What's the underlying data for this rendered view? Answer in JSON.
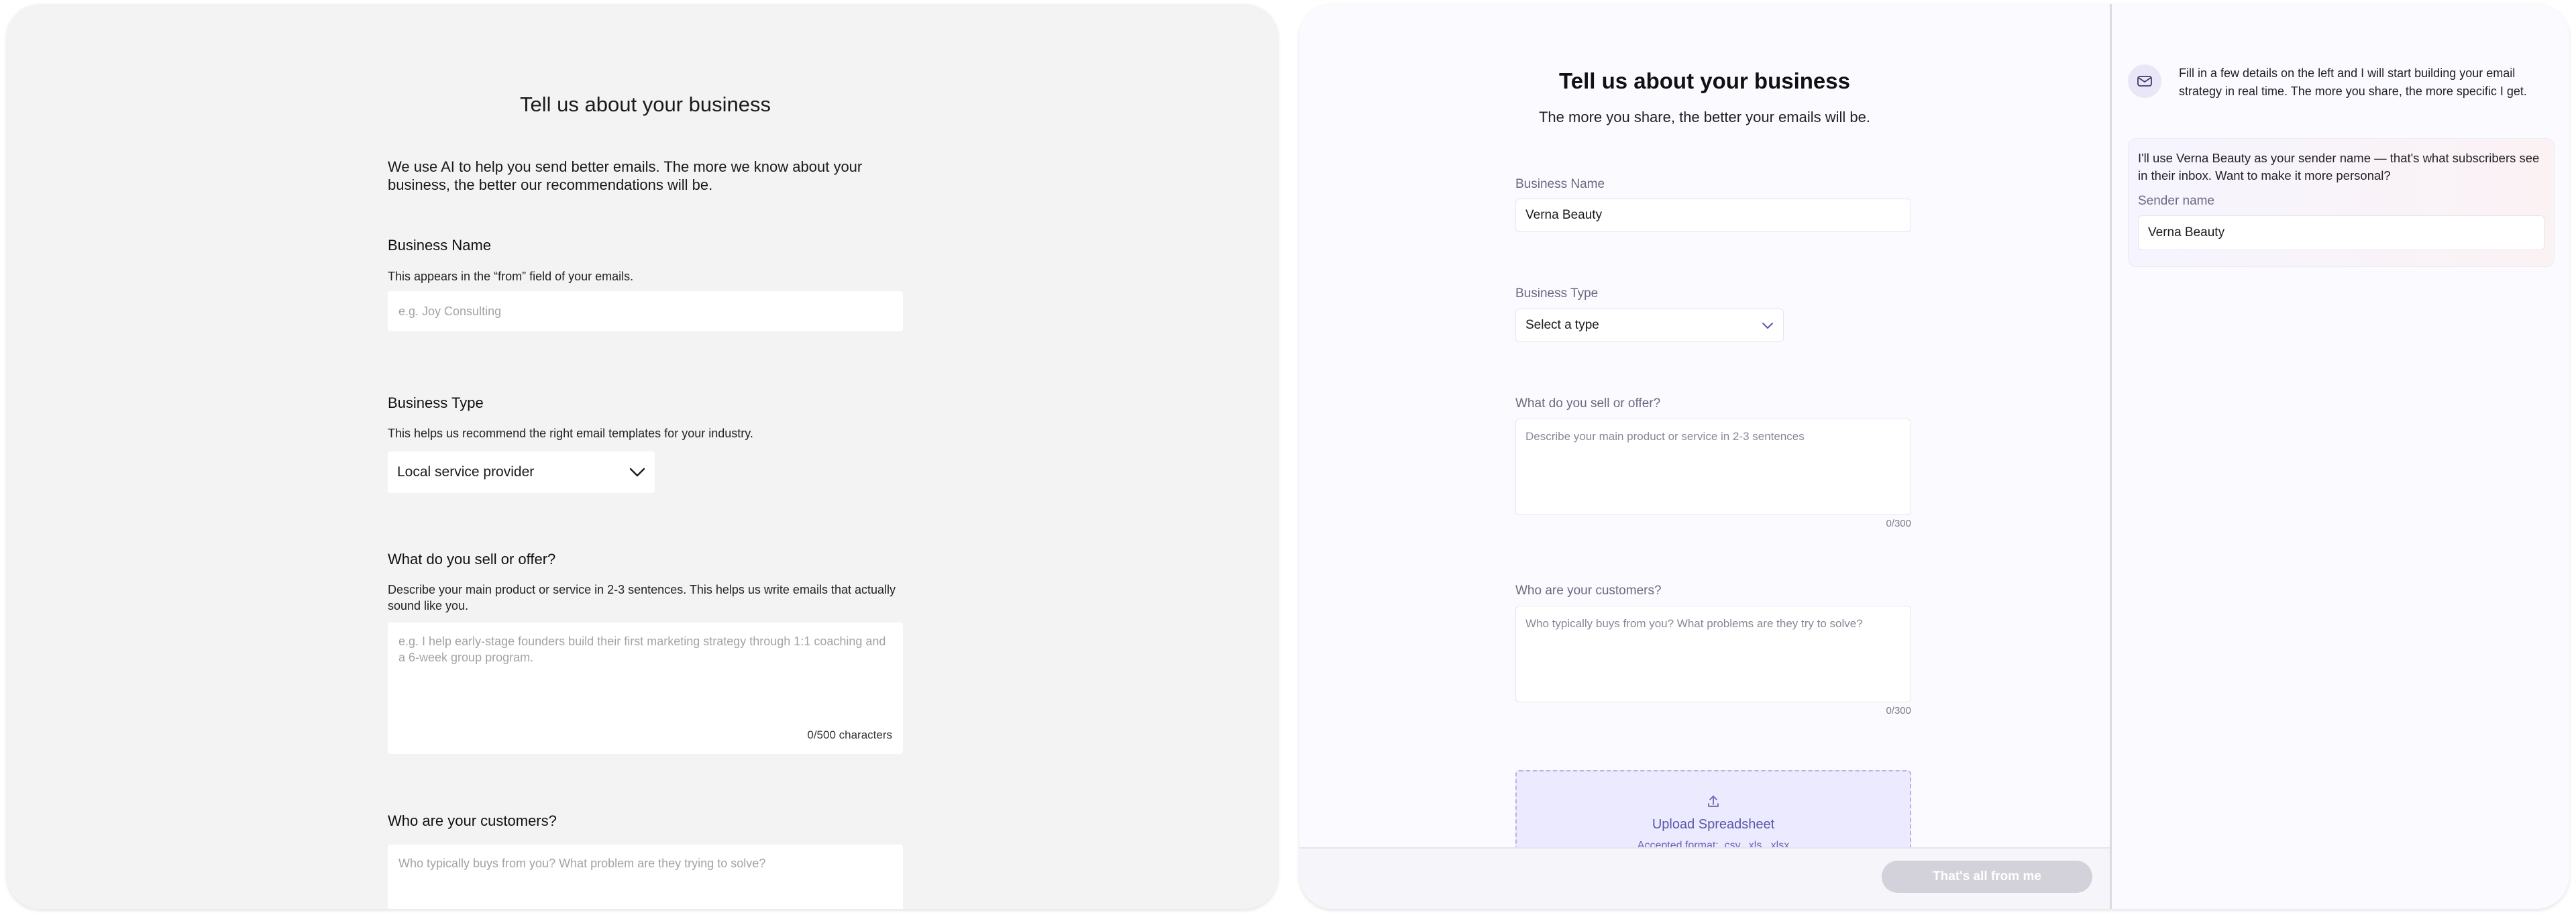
{
  "left": {
    "title": "Tell us about your business",
    "intro": "We use AI to help you send better emails. The more we know about your business, the better our recommendations will be.",
    "business_name": {
      "label": "Business Name",
      "help": "This appears in the “from” field of your emails.",
      "placeholder": "e.g. Joy Consulting"
    },
    "business_type": {
      "label": "Business Type",
      "help": "This helps us recommend the right email templates for your industry.",
      "selected": "Local service provider"
    },
    "sell": {
      "label": "What do you sell or offer?",
      "help": "Describe your main product or service in 2-3 sentences. This helps us write emails that actually sound like you.",
      "placeholder": "e.g. I help early-stage founders build their first marketing strategy through 1:1 coaching and a 6-week group program.",
      "counter": "0/500 characters"
    },
    "customers": {
      "label": "Who are your customers?",
      "placeholder": "Who typically buys from you? What problem are they trying to solve?"
    }
  },
  "right": {
    "title": "Tell us about your business",
    "subtitle": "The more you share, the better your emails will be.",
    "business_name": {
      "label": "Business Name",
      "value": "Verna Beauty"
    },
    "business_type": {
      "label": "Business Type",
      "selected": "Select a type"
    },
    "sell": {
      "label": "What do you sell or offer?",
      "placeholder": "Describe your main product or service in 2-3 sentences",
      "count": "0/300"
    },
    "customers": {
      "label": "Who are your customers?",
      "placeholder": "Who typically buys from you? What problems are they try to solve?",
      "count": "0/300"
    },
    "upload": {
      "title": "Upload Spreadsheet",
      "formats": "Accepted format: .csv, .xls, .xlsx"
    },
    "done_button": "That's all from me",
    "chat": {
      "intro": "Fill in a few details on the left and I will start building your email strategy in real time. The more you share, the more specific I get.",
      "card_text": "I'll use Verna Beauty as your sender name — that's what subscribers see in their inbox. Want to make it more personal?",
      "sender_label": "Sender name",
      "sender_value": "Verna Beauty"
    }
  },
  "icons": {
    "chevron": "chevron-down-icon",
    "upload": "upload-icon",
    "mail": "mail-icon"
  },
  "colors": {
    "accent": "#5a56a8",
    "left_bg": "#f3f3f3",
    "right_bg": "#fbfaff",
    "upload_bg": "#eceaff",
    "disabled_button": "#d3d1d9"
  }
}
